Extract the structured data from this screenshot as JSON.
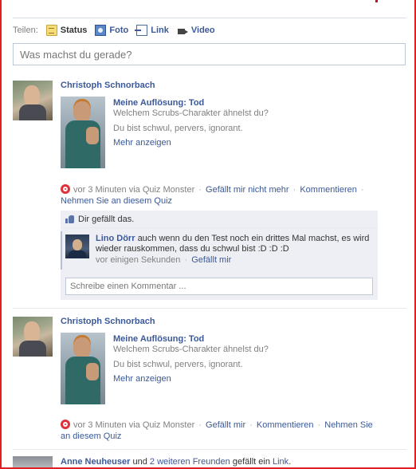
{
  "composer": {
    "share_label": "Teilen:",
    "items": [
      {
        "label": "Status",
        "icon": "status-icon"
      },
      {
        "label": "Foto",
        "icon": "photo-icon"
      },
      {
        "label": "Link",
        "icon": "link-icon"
      },
      {
        "label": "Video",
        "icon": "video-icon"
      }
    ],
    "placeholder": "Was machst du gerade?"
  },
  "stories": [
    {
      "author": "Christoph Schnorbach",
      "attachment": {
        "title": "Meine Auflösung: Tod",
        "subtitle": "Welchem Scrubs-Charakter ähnelst du?",
        "description": "Du bist schwul, pervers, ignorant.",
        "more": "Mehr anzeigen"
      },
      "meta": {
        "time": "vor 3 Minuten via Quiz Monster",
        "actions": [
          "Gefällt mir nicht mehr",
          "Kommentieren",
          "Nehmen Sie an diesem Quiz"
        ]
      },
      "likes": "Dir gefällt das.",
      "comment": {
        "author": "Lino Dörr",
        "text": "auch wenn du den Test noch ein drittes Mal machst, es wird wieder rauskommen, dass du schwul bist :D :D :D",
        "time": "vor einigen Sekunden",
        "action": "Gefällt mir"
      },
      "comment_placeholder": "Schreibe einen Kommentar ..."
    },
    {
      "author": "Christoph Schnorbach",
      "attachment": {
        "title": "Meine Auflösung: Tod",
        "subtitle": "Welchem Scrubs-Charakter ähnelst du?",
        "description": "Du bist schwul, pervers, ignorant.",
        "more": "Mehr anzeigen"
      },
      "meta": {
        "time": "vor 3 Minuten via Quiz Monster",
        "actions": [
          "Gefällt mir",
          "Kommentieren",
          "Nehmen Sie an diesem Quiz"
        ]
      }
    }
  ],
  "bottom_story": {
    "author": "Anne Neuheuser",
    "text_mid": " und ",
    "others": "2 weiteren Freunden",
    "text_end": " gefällt ein ",
    "link": "Link",
    "end": "."
  },
  "colors": {
    "link": "#3b5998",
    "muted": "#808080",
    "frame": "#e02020",
    "ufi_bg": "#edeff4"
  }
}
